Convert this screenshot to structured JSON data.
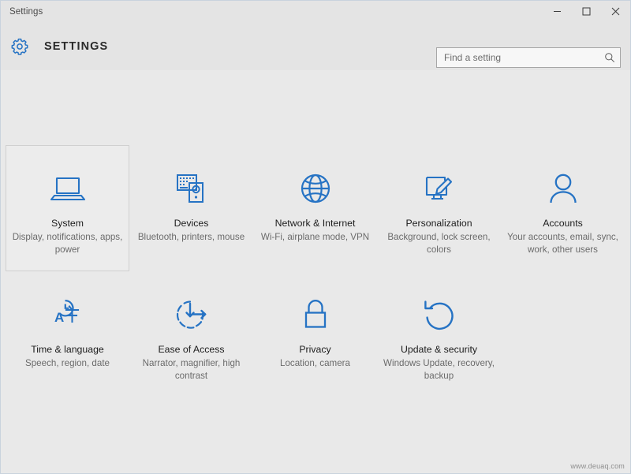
{
  "window": {
    "titlebar_text": "Settings",
    "controls": {
      "minimize": "minimize",
      "maximize": "maximize",
      "close": "close"
    }
  },
  "header": {
    "gear_icon": "gear-icon",
    "app_title": "SETTINGS"
  },
  "search": {
    "value": "",
    "placeholder": "Find a setting",
    "icon": "search-icon"
  },
  "tiles": [
    {
      "id": "system",
      "icon": "laptop-icon",
      "title": "System",
      "desc": "Display, notifications, apps, power",
      "selected": true
    },
    {
      "id": "devices",
      "icon": "keyboard-mouse-icon",
      "title": "Devices",
      "desc": "Bluetooth, printers, mouse",
      "selected": false
    },
    {
      "id": "network-internet",
      "icon": "globe-icon",
      "title": "Network & Internet",
      "desc": "Wi-Fi, airplane mode, VPN",
      "selected": false
    },
    {
      "id": "personalization",
      "icon": "monitor-brush-icon",
      "title": "Personalization",
      "desc": "Background, lock screen, colors",
      "selected": false
    },
    {
      "id": "accounts",
      "icon": "person-icon",
      "title": "Accounts",
      "desc": "Your accounts, email, sync, work, other users",
      "selected": false
    },
    {
      "id": "time-language",
      "icon": "clock-language-icon",
      "title": "Time & language",
      "desc": "Speech, region, date",
      "selected": false
    },
    {
      "id": "ease-of-access",
      "icon": "ease-of-access-icon",
      "title": "Ease of Access",
      "desc": "Narrator, magnifier, high contrast",
      "selected": false
    },
    {
      "id": "privacy",
      "icon": "lock-icon",
      "title": "Privacy",
      "desc": "Location, camera",
      "selected": false
    },
    {
      "id": "update-security",
      "icon": "refresh-circle-icon",
      "title": "Update & security",
      "desc": "Windows Update, recovery, backup",
      "selected": false
    }
  ],
  "watermark": {
    "text": "www.deuaq.com"
  },
  "colors": {
    "accent_blue": "#2673c4",
    "page_background": "#e9e9e9",
    "chrome_background": "#e4e4e4",
    "title_text": "#1c1c1c",
    "desc_text": "#6b6b6b"
  }
}
